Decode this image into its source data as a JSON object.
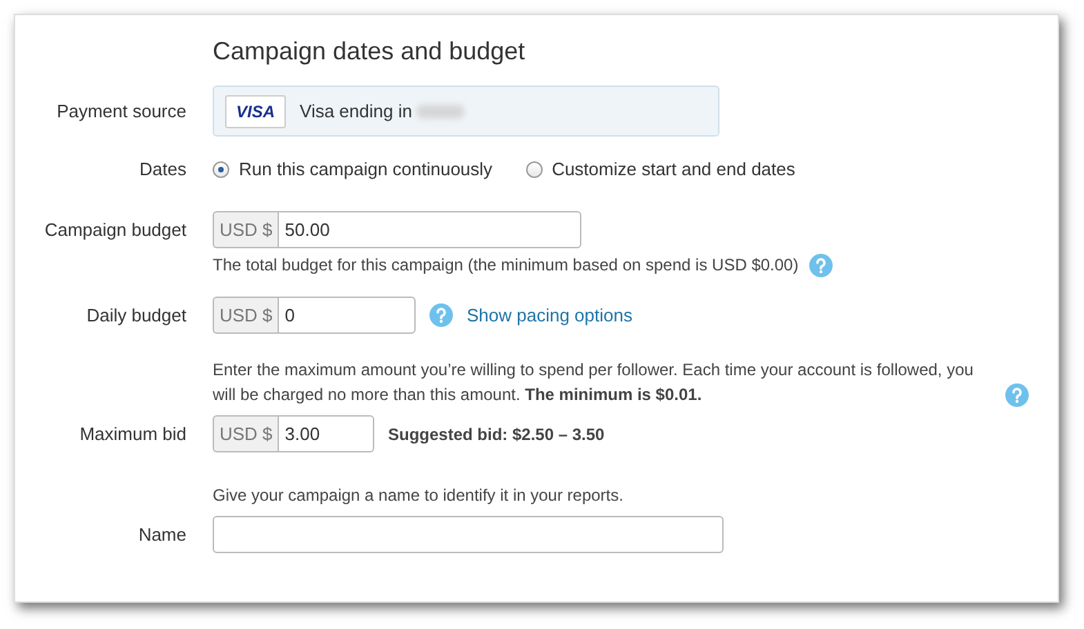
{
  "title": "Campaign dates and budget",
  "payment_source": {
    "label": "Payment source",
    "card_brand": "VISA",
    "text": "Visa ending in",
    "number_redacted": true
  },
  "dates": {
    "label": "Dates",
    "options": [
      {
        "label": "Run this campaign continuously",
        "selected": true
      },
      {
        "label": "Customize start and end dates",
        "selected": false
      }
    ]
  },
  "campaign_budget": {
    "label": "Campaign budget",
    "currency": "USD $",
    "value": "50.00",
    "hint": "The total budget for this campaign (the minimum based on spend is USD $0.00)"
  },
  "daily_budget": {
    "label": "Daily budget",
    "currency": "USD $",
    "value": "0",
    "link": "Show pacing options"
  },
  "maximum_bid": {
    "intro": "Enter the maximum amount you’re willing to spend per follower. Each time your account is followed, you will be charged no more than this amount. **The minimum is $0.01.**",
    "label": "Maximum bid",
    "currency": "USD $",
    "value": "3.00",
    "suggestion": "Suggested bid: $2.50 – 3.50"
  },
  "name": {
    "intro": "Give your campaign a name to identify it in your reports.",
    "label": "Name"
  }
}
